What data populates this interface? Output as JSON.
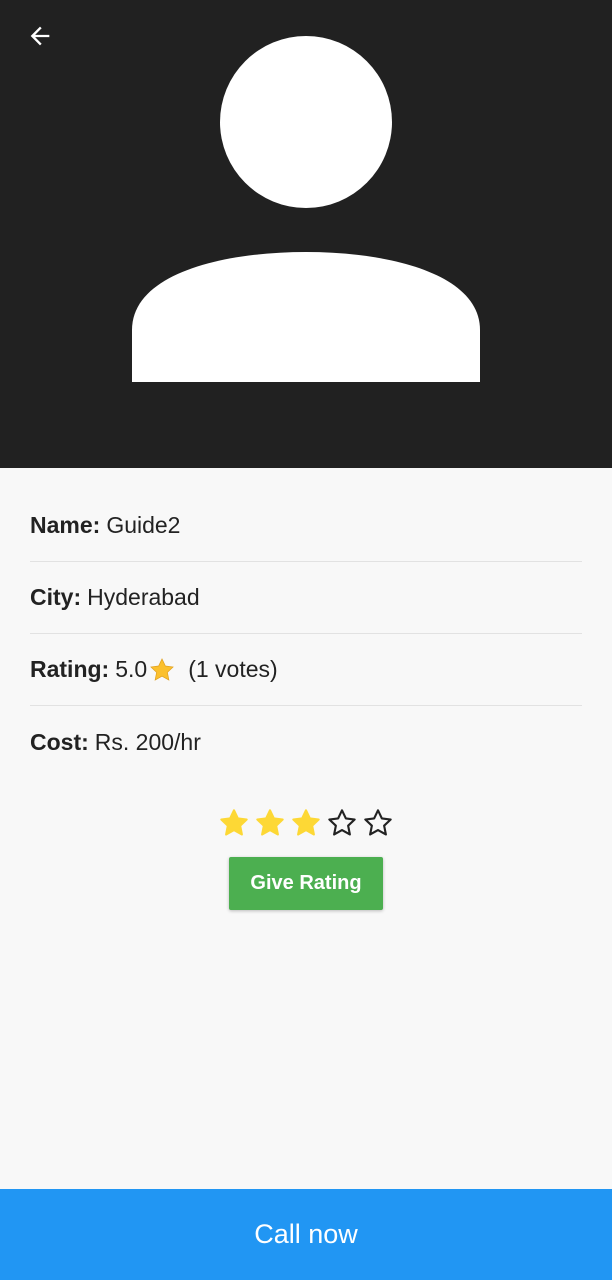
{
  "header": {
    "back_icon": "arrow-left-icon",
    "avatar_icon": "person-icon",
    "background_color": "#212121"
  },
  "profile": {
    "name_label": "Name:",
    "name_value": "Guide2",
    "city_label": "City:",
    "city_value": "Hyderabad",
    "rating_label": "Rating:",
    "rating_value": "5.0",
    "rating_icon": "star-icon",
    "votes": "(1 votes)",
    "cost_label": "Cost:",
    "cost_value": "Rs. 200/hr"
  },
  "rating_input": {
    "selected": 3,
    "max": 5,
    "filled_color": "#fdd835"
  },
  "actions": {
    "give_rating_label": "Give Rating",
    "give_rating_color": "#4caf50",
    "call_now_label": "Call now",
    "call_now_color": "#2196f3"
  }
}
